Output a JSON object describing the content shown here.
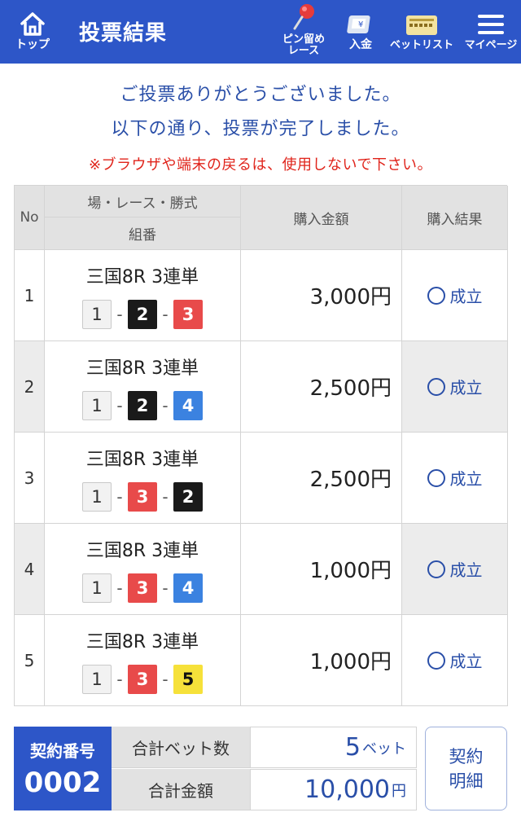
{
  "header": {
    "home_label": "トップ",
    "title": "投票結果",
    "pin_label_1": "ピン留め",
    "pin_label_2": "レース",
    "deposit_label": "入金",
    "betlist_label": "ベットリスト",
    "mypage_label": "マイページ",
    "brand_color": "#2d56c8"
  },
  "messages": {
    "thanks": "ご投票ありがとうございました。",
    "complete": "以下の通り、投票が完了しました。",
    "warning": "※ブラウザや端末の戻るは、使用しないで下さい。"
  },
  "table": {
    "headers": {
      "no": "No",
      "race": "場・レース・勝式",
      "combo": "組番",
      "amount": "購入金額",
      "result": "購入結果"
    },
    "rows": [
      {
        "no": "1",
        "race": "三国8R 3連単",
        "combo": [
          "1",
          "2",
          "3"
        ],
        "amount": "3,000円",
        "result": "成立"
      },
      {
        "no": "2",
        "race": "三国8R 3連単",
        "combo": [
          "1",
          "2",
          "4"
        ],
        "amount": "2,500円",
        "result": "成立"
      },
      {
        "no": "3",
        "race": "三国8R 3連単",
        "combo": [
          "1",
          "3",
          "2"
        ],
        "amount": "2,500円",
        "result": "成立"
      },
      {
        "no": "4",
        "race": "三国8R 3連単",
        "combo": [
          "1",
          "3",
          "4"
        ],
        "amount": "1,000円",
        "result": "成立"
      },
      {
        "no": "5",
        "race": "三国8R 3連単",
        "combo": [
          "1",
          "3",
          "5"
        ],
        "amount": "1,000円",
        "result": "成立"
      }
    ],
    "dash": "-"
  },
  "summary": {
    "contract_label": "契約番号",
    "contract_no": "0002",
    "bets_label": "合計ベット数",
    "bets_value": "5",
    "bets_unit": "ベット",
    "total_label": "合計金額",
    "total_value": "10,000",
    "total_unit": "円",
    "detail_button_1": "契約",
    "detail_button_2": "明細"
  }
}
